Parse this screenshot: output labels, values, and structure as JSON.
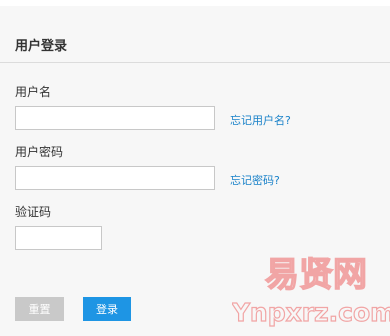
{
  "form": {
    "title": "用户登录",
    "username_label": "用户名",
    "username_value": "",
    "password_label": "用户密码",
    "password_value": "",
    "captcha_label": "验证码",
    "captcha_value": "",
    "forgot_username": "忘记用户名?",
    "forgot_password": "忘记密码?",
    "reset_label": "重置",
    "login_label": "登录"
  },
  "watermark": {
    "top": "易贤网",
    "bottom": "Ynpxrz.com"
  },
  "colors": {
    "link": "#1a82c9",
    "login_button": "#1e95e4",
    "reset_button": "#c9c9c9",
    "watermark": "#f08a8a"
  }
}
